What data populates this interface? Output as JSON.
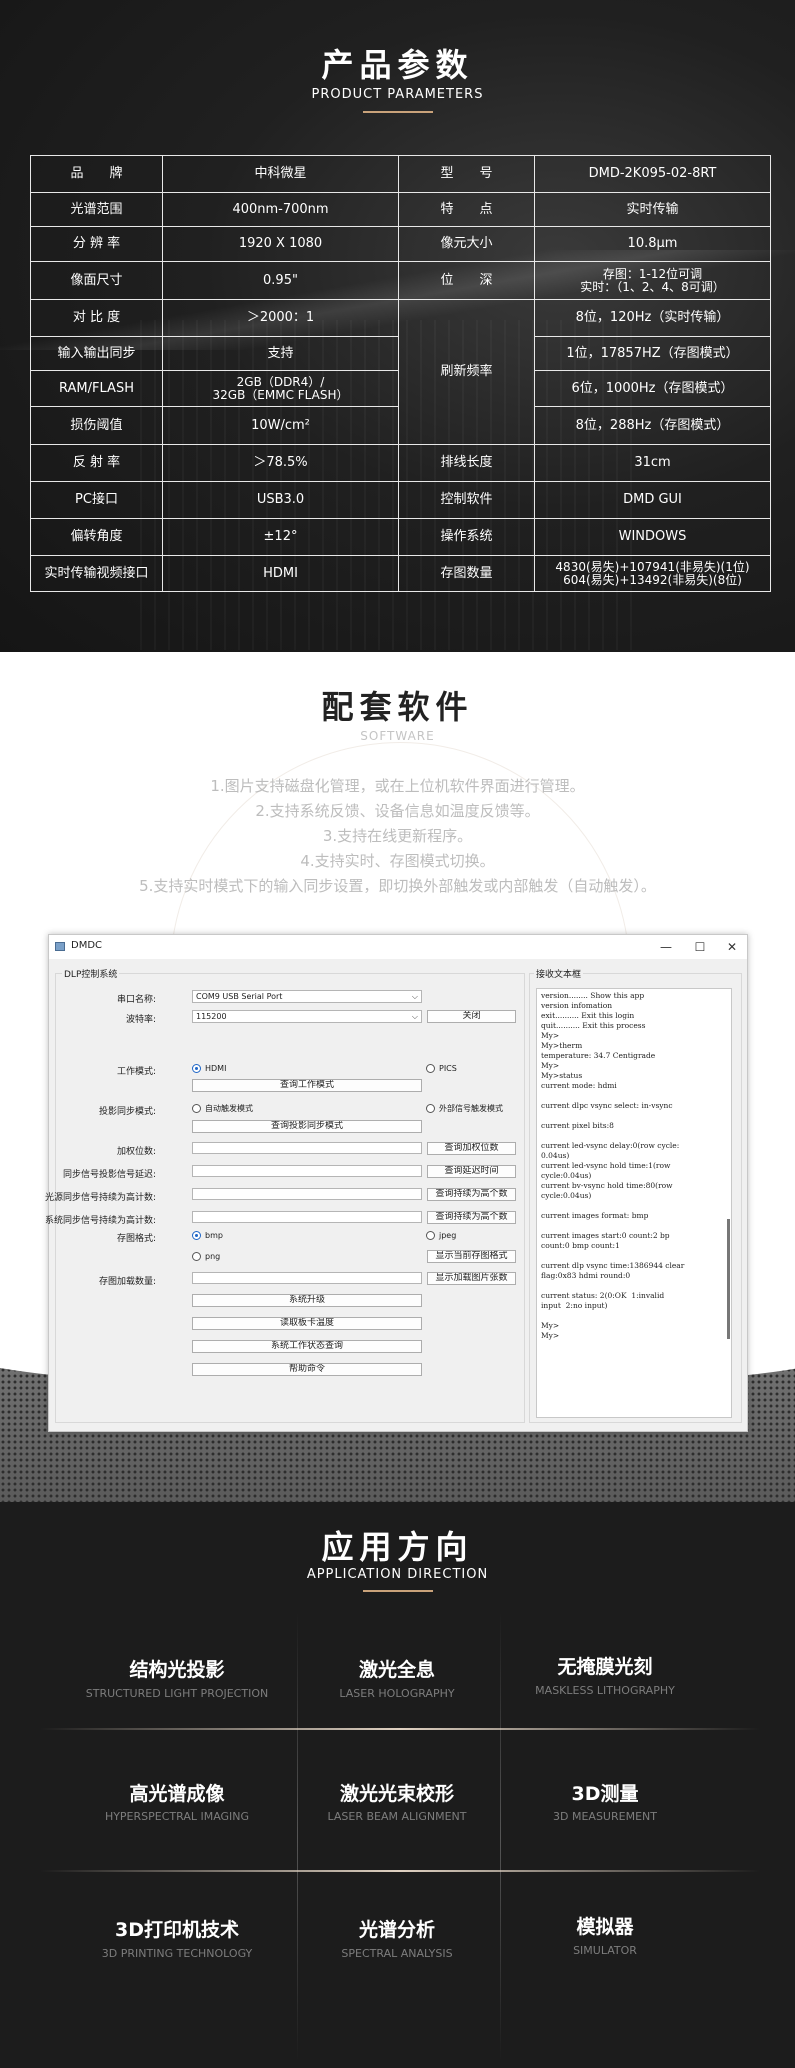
{
  "params": {
    "title_cn": "产品参数",
    "title_en": "PRODUCT  PARAMETERS",
    "rows": [
      {
        "k1": "品　　牌",
        "v1": "中科微星",
        "k2": "型　　号",
        "v2": "DMD-2K095-02-8RT"
      },
      {
        "k1": "光谱范围",
        "v1": "400nm-700nm",
        "k2": "特　　点",
        "v2": "实时传输"
      },
      {
        "k1": "分 辨 率",
        "v1": "1920 X 1080",
        "k2": "像元大小",
        "v2": "10.8μm"
      },
      {
        "k1": "像面尺寸",
        "v1": "0.95\"",
        "k2": "位　　深",
        "v2a": "存图：1-12位可调",
        "v2b": "实时：（1、2、4、8可调）"
      },
      {
        "k1": "对 比 度",
        "v1": "＞2000：1",
        "v2": "8位，120Hz（实时传输）"
      },
      {
        "k1": "输入输出同步",
        "v1": "支持",
        "k2": "刷新频率",
        "v2": "1位，17857HZ（存图模式）"
      },
      {
        "k1": "RAM/FLASH",
        "v1a": "2GB（DDR4）/",
        "v1b": "32GB（EMMC FLASH）",
        "v2": "6位，1000Hz（存图模式）"
      },
      {
        "k1": "损伤阈值",
        "v1": "10W/cm²",
        "v2": "8位，288Hz（存图模式）"
      },
      {
        "k1": "反 射 率",
        "v1": "＞78.5%",
        "k2": "排线长度",
        "v2": "31cm"
      },
      {
        "k1": "PC接口",
        "v1": "USB3.0",
        "k2": "控制软件",
        "v2": "DMD GUI"
      },
      {
        "k1": "偏转角度",
        "v1": "±12°",
        "k2": "操作系统",
        "v2": "WINDOWS"
      },
      {
        "k1": "实时传输视频接口",
        "v1": "HDMI",
        "k2": "存图数量",
        "v2a": "4830(易失)+107941(非易失)(1位)",
        "v2b": "604(易失)+13492(非易失)(8位)"
      }
    ]
  },
  "software": {
    "title_cn": "配套软件",
    "title_en": "SOFTWARE",
    "features": [
      "1.图片支持磁盘化管理，或在上位机软件界面进行管理。",
      "2.支持系统反馈、设备信息如温度反馈等。",
      "3.支持在线更新程序。",
      "4.支持实时、存图模式切换。",
      "5.支持实时模式下的输入同步设置，即切换外部触发或内部触发（自动触发）。"
    ],
    "window": {
      "title": "DMDC",
      "min": "—",
      "max": "☐",
      "close": "✕",
      "group_left": "DLP控制系统",
      "group_right": "接收文本框",
      "port_label": "串口名称:",
      "port_value": "COM9   USB Serial Port",
      "baud_label": "波特率:",
      "baud_value": "115200",
      "close_btn": "关闭",
      "work_mode_label": "工作模式:",
      "hdmi": "HDMI",
      "pics": "PICS",
      "query_work_mode": "查询工作模式",
      "sync_label": "投影同步模式:",
      "auto_trigger": "自动触发模式",
      "ext_trigger": "外部信号触发模式",
      "query_sync": "查询投影同步模式",
      "weight_label": "加权位数:",
      "query_weight": "查询加权位数",
      "delay_label": "同步信号投影信号延迟:",
      "query_delay": "查询延迟时间",
      "light_label": "光源同步信号持续为高计数:",
      "query_light": "查询持续为高个数",
      "sys_label": "系统同步信号持续为高计数:",
      "query_sys": "查询持续为高个数",
      "fmt_label": "存图格式:",
      "bmp": "bmp",
      "jpeg": "jpeg",
      "png": "png",
      "show_fmt": "显示当前存图格式",
      "load_label": "存图加载数量:",
      "show_load": "显示加载图片张数",
      "upgrade": "系统升级",
      "read_temp": "读取板卡温度",
      "status_query": "系统工作状态查询",
      "help": "帮助命令",
      "terminal": "version........ Show this app\nversion infomation\nexit.......... Exit this login\nquit.......... Exit this process\nMy>\nMy>therm\ntemperature: 34.7 Centigrade\nMy>\nMy>status\ncurrent mode: hdmi\n\ncurrent dlpc vsync select: in-vsync\n\ncurrent pixel bits:8\n\ncurrent led-vsync delay:0(row cycle:\n0.04us)\ncurrent led-vsync hold time:1(row\ncycle:0.04us)\ncurrent bv-vsync hold time:80(row\ncycle:0.04us)\n\ncurrent images format: bmp\n\ncurrent images start:0 count:2 bp\ncount:0 bmp count:1\n\ncurrent dlp vsync time:1386944 clear\nflag:0x83 hdmi round:0\n\ncurrent status: 2(0:OK  1:invalid\ninput  2:no input)\n\nMy>\nMy>"
    }
  },
  "application": {
    "title_cn": "应用方向",
    "title_en": "APPLICATION DIRECTION",
    "items": [
      {
        "cn": "结构光投影",
        "en": "STRUCTURED LIGHT PROJECTION"
      },
      {
        "cn": "激光全息",
        "en": "LASER HOLOGRAPHY"
      },
      {
        "cn": "无掩膜光刻",
        "en": "MASKLESS LITHOGRAPHY"
      },
      {
        "cn": "高光谱成像",
        "en": "HYPERSPECTRAL IMAGING"
      },
      {
        "cn": "激光光束校形",
        "en": "LASER BEAM ALIGNMENT"
      },
      {
        "cn": "3D测量",
        "en": "3D MEASUREMENT"
      },
      {
        "cn": "3D打印机技术",
        "en": "3D PRINTING TECHNOLOGY"
      },
      {
        "cn": "光谱分析",
        "en": "SPECTRAL ANALYSIS"
      },
      {
        "cn": "模拟器",
        "en": "SIMULATOR"
      }
    ]
  }
}
